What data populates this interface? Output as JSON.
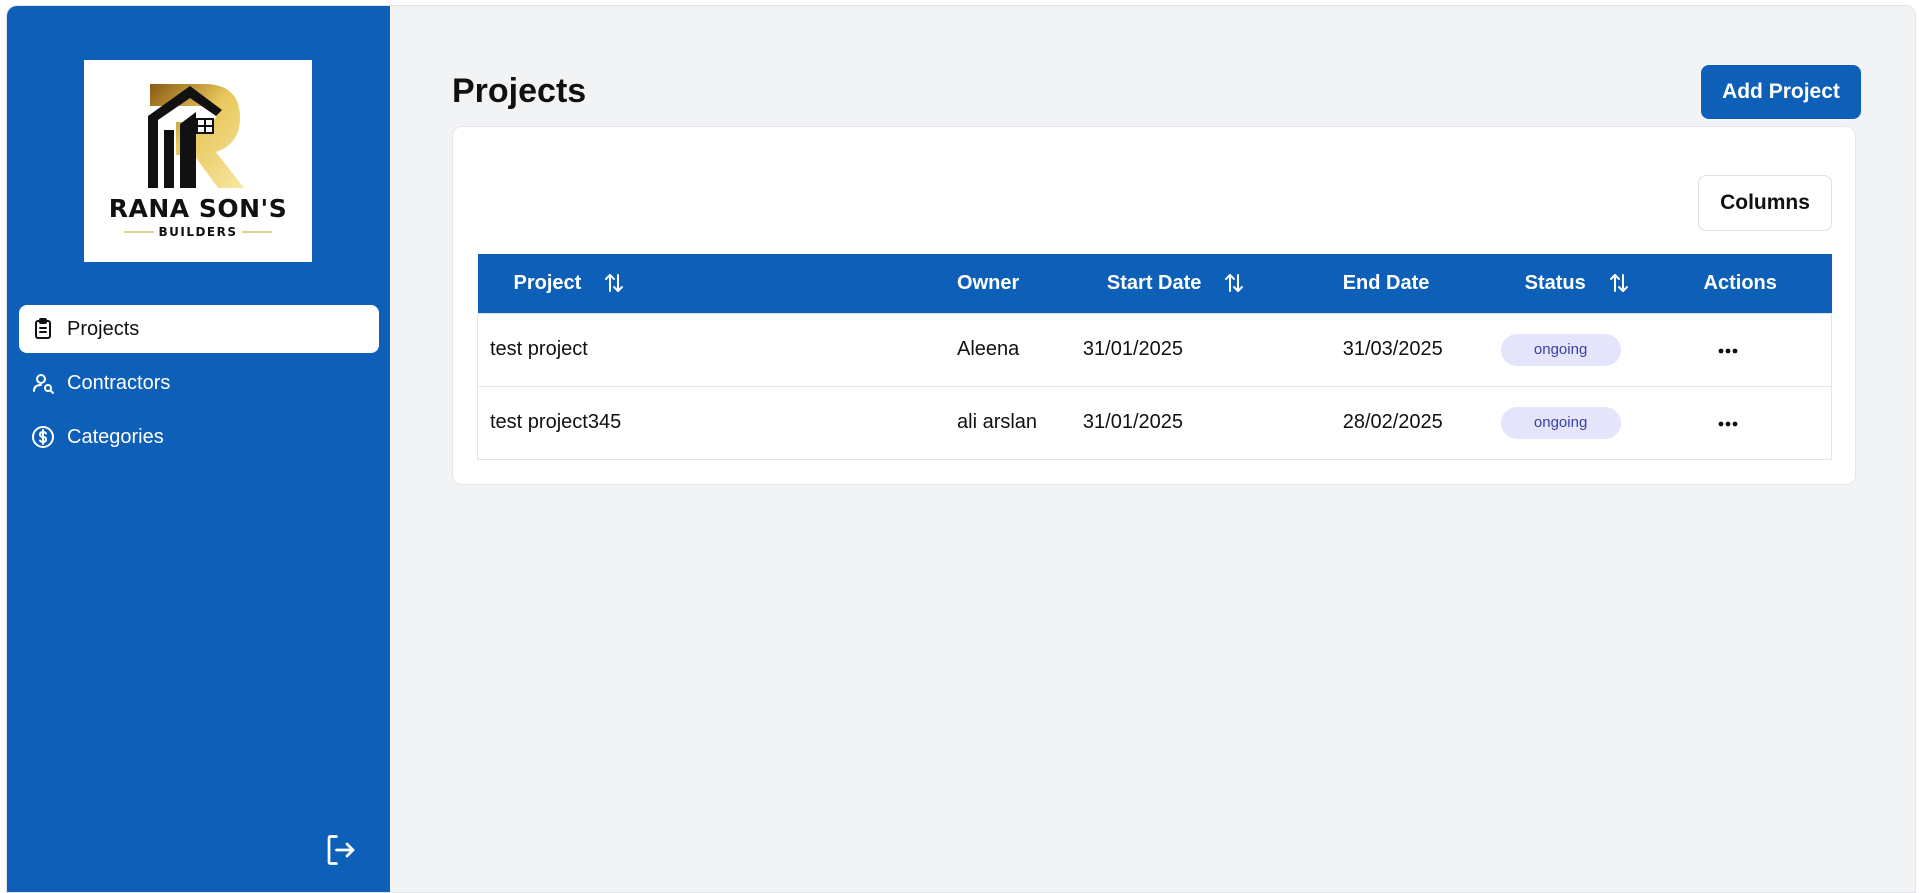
{
  "brand": {
    "name_line1": "RANA SON'S",
    "name_line2": "BUILDERS",
    "colors": {
      "primary": "#0d5fb8",
      "gold": "#c9a227"
    }
  },
  "sidebar": {
    "items": [
      {
        "label": "Projects",
        "icon": "clipboard-icon",
        "active": true
      },
      {
        "label": "Contractors",
        "icon": "user-search-icon",
        "active": false
      },
      {
        "label": "Categories",
        "icon": "dollar-circle-icon",
        "active": false
      }
    ],
    "logout_icon": "logout-icon"
  },
  "header": {
    "title": "Projects",
    "add_button": "Add Project"
  },
  "table": {
    "columns_button": "Columns",
    "headers": {
      "project": "Project",
      "owner": "Owner",
      "start_date": "Start Date",
      "end_date": "End Date",
      "status": "Status",
      "actions": "Actions"
    },
    "rows": [
      {
        "project": "test project",
        "owner": "Aleena",
        "start_date": "31/01/2025",
        "end_date": "31/03/2025",
        "status": "ongoing"
      },
      {
        "project": "test project345",
        "owner": "ali arslan",
        "start_date": "31/01/2025",
        "end_date": "28/02/2025",
        "status": "ongoing"
      }
    ]
  }
}
